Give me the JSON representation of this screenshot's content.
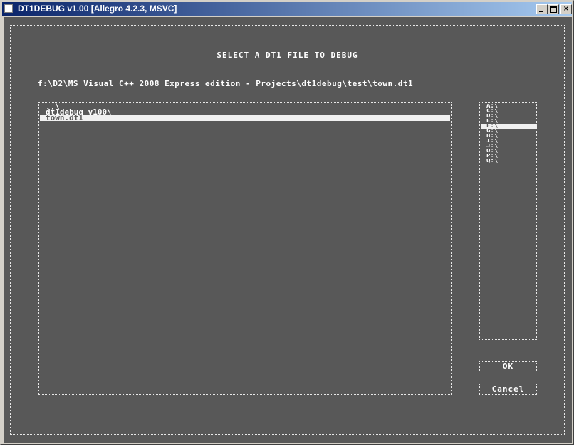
{
  "window": {
    "title": "DT1DEBUG v1.00 [Allegro 4.2.3, MSVC]",
    "controls": {
      "minimize": "minimize",
      "maximize": "maximize",
      "close": "×"
    }
  },
  "dialog": {
    "title": "SELECT A DT1 FILE TO DEBUG",
    "path": "f:\\D2\\MS Visual C++ 2008 Express edition - Projects\\dt1debug\\test\\town.dt1",
    "files": [
      {
        "label": "..\\",
        "selected": false
      },
      {
        "label": "dt1debug_v100\\",
        "selected": false
      },
      {
        "label": "town.dt1",
        "selected": true
      }
    ],
    "drives": [
      {
        "label": "A:\\",
        "selected": false
      },
      {
        "label": "C:\\",
        "selected": false
      },
      {
        "label": "D:\\",
        "selected": false
      },
      {
        "label": "E:\\",
        "selected": false
      },
      {
        "label": "F:\\",
        "selected": true
      },
      {
        "label": "G:\\",
        "selected": false
      },
      {
        "label": "H:\\",
        "selected": false
      },
      {
        "label": "I:\\",
        "selected": false
      },
      {
        "label": "J:\\",
        "selected": false
      },
      {
        "label": "O:\\",
        "selected": false
      },
      {
        "label": "P:\\",
        "selected": false
      },
      {
        "label": "Q:\\",
        "selected": false
      }
    ],
    "ok_label": "OK",
    "cancel_label": "Cancel"
  },
  "colors": {
    "background": "#585858",
    "foreground": "#ffffff",
    "selection": "#f0f0f0"
  }
}
